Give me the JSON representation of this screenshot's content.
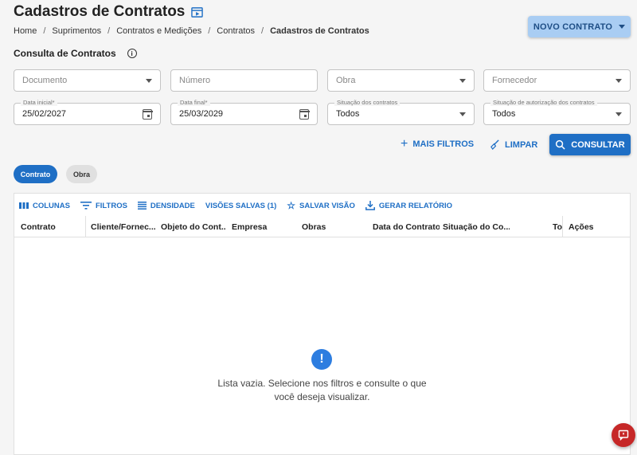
{
  "page": {
    "title": "Cadastros de Contratos",
    "breadcrumb": [
      "Home",
      "Suprimentos",
      "Contratos e Medições",
      "Contratos",
      "Cadastros de Contratos"
    ],
    "new_button": "NOVO CONTRATO"
  },
  "filters": {
    "section_title": "Consulta de Contratos",
    "documento": {
      "placeholder": "Documento"
    },
    "numero": {
      "placeholder": "Número"
    },
    "obra": {
      "placeholder": "Obra"
    },
    "fornecedor": {
      "placeholder": "Fornecedor"
    },
    "data_inicial": {
      "label": "Data inicial*",
      "value": "25/02/2027"
    },
    "data_final": {
      "label": "Data final*",
      "value": "25/03/2029"
    },
    "situacao_contratos": {
      "label": "Situação dos contratos",
      "value": "Todos"
    },
    "situacao_autorizacao": {
      "label": "Situação de autorização dos contratos",
      "value": "Todos"
    },
    "mais_filtros": "MAIS FILTROS",
    "limpar": "LIMPAR",
    "consultar": "CONSULTAR"
  },
  "chips": {
    "contrato": "Contrato",
    "obra": "Obra"
  },
  "toolbar": {
    "colunas": "COLUNAS",
    "filtros": "FILTROS",
    "densidade": "DENSIDADE",
    "visoes_salvas": "VISÕES SALVAS (1)",
    "salvar_visao": "SALVAR VISÃO",
    "gerar_relatorio": "GERAR RELATÓRIO"
  },
  "columns": [
    "Contrato",
    "Cliente/Fornec...",
    "Objeto do Cont...",
    "Empresa",
    "Obras",
    "Data do Contrato",
    "Situação do Co...",
    "To",
    "Ações"
  ],
  "empty_state": {
    "line1": "Lista vazia. Selecione nos filtros e consulte o que",
    "line2": "você deseja visualizar."
  },
  "colors": {
    "primary": "#1f6fc5",
    "accent_light": "#a9cdf3",
    "fab": "#c62828"
  }
}
